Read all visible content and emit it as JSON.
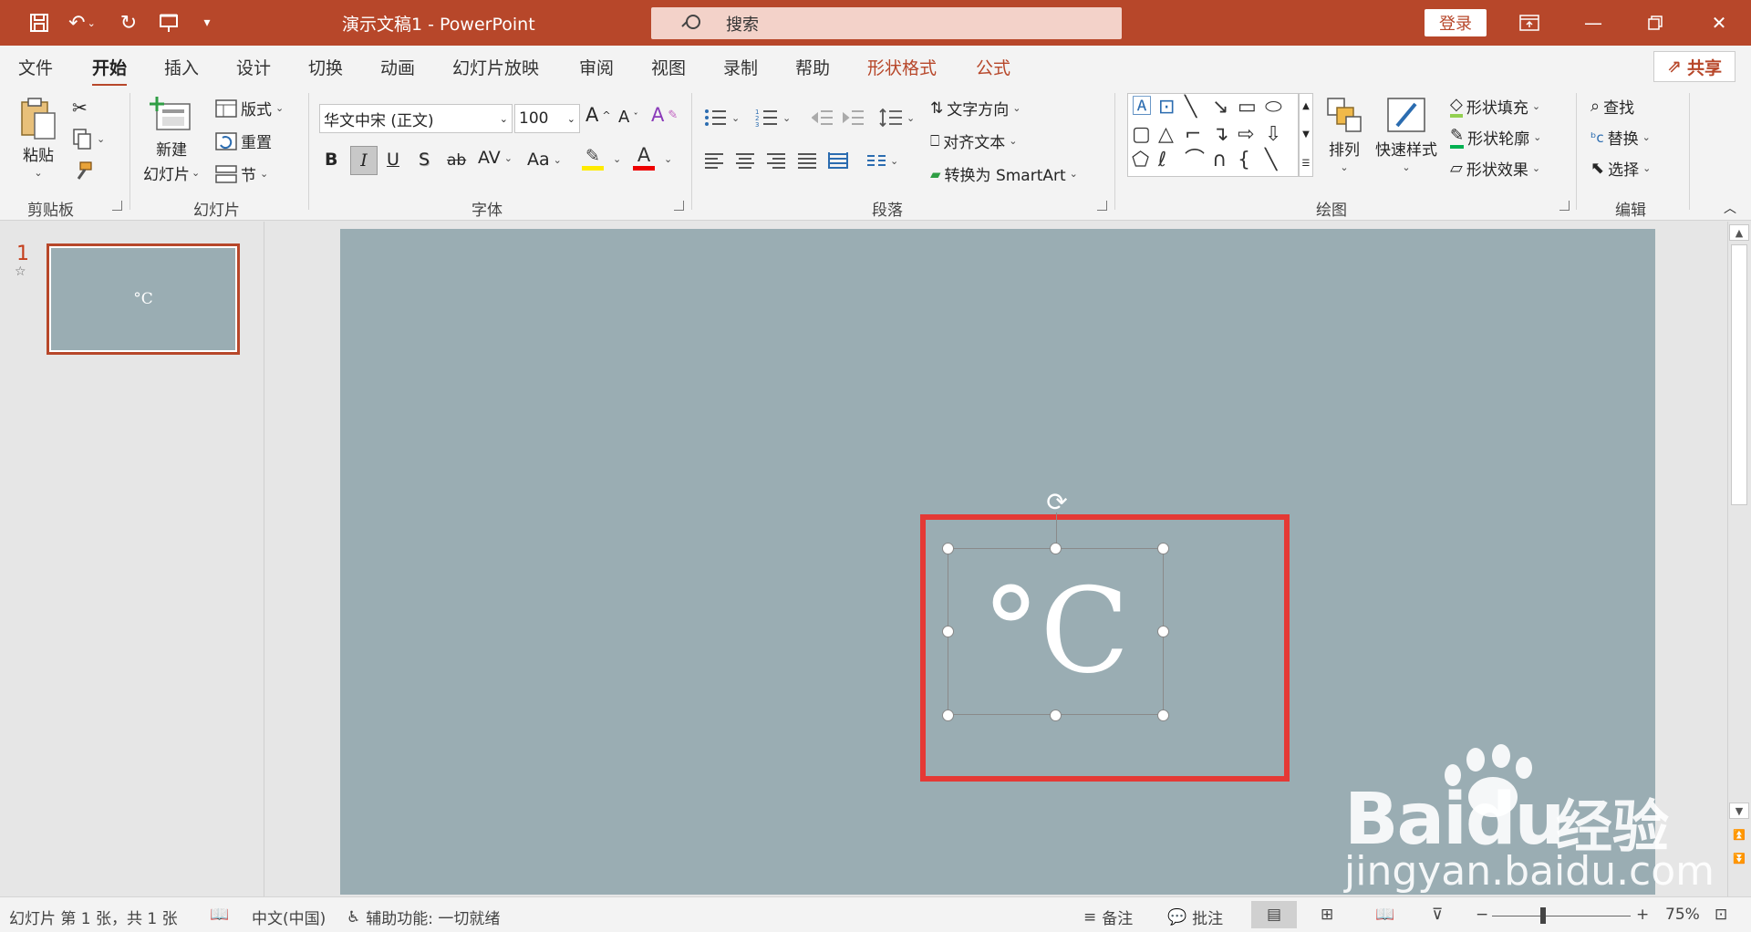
{
  "titlebar": {
    "doc_title": "演示文稿1  -  PowerPoint",
    "search_label": "搜索",
    "signin_label": "登录",
    "accent_color": "#b7472a"
  },
  "tabs": [
    "文件",
    "开始",
    "插入",
    "设计",
    "切换",
    "动画",
    "幻灯片放映",
    "审阅",
    "视图",
    "录制",
    "帮助",
    "形状格式",
    "公式"
  ],
  "active_tab": "开始",
  "share_label": "共享",
  "ribbon": {
    "clipboard": {
      "paste": "粘贴",
      "group": "剪贴板"
    },
    "slides": {
      "new_slide_1": "新建",
      "new_slide_2": "幻灯片",
      "layout": "版式",
      "reset": "重置",
      "section": "节",
      "group": "幻灯片"
    },
    "font": {
      "name": "华文中宋 (正文)",
      "size": "100",
      "bold": "B",
      "italic": "I",
      "underline": "U",
      "shadow": "S",
      "strike": "ab",
      "spacing": "AV",
      "case": "Aa",
      "group": "字体"
    },
    "paragraph": {
      "text_direction": "文字方向",
      "align_text": "对齐文本",
      "smartart": "转换为 SmartArt",
      "group": "段落"
    },
    "drawing": {
      "arrange": "排列",
      "quick_styles": "快速样式",
      "shape_fill": "形状填充",
      "shape_outline": "形状轮廓",
      "shape_effects": "形状效果",
      "group": "绘图"
    },
    "editing": {
      "find": "查找",
      "replace": "替换",
      "select": "选择",
      "group": "编辑"
    }
  },
  "thumbnail": {
    "number": "1",
    "text": "°C"
  },
  "slide": {
    "text": "°C",
    "background": "#9aadb3",
    "highlight_color": "#e53935"
  },
  "watermark": {
    "brand": "Bai",
    "brand2": "du",
    "cn": "经验",
    "url": "jingyan.baidu.com"
  },
  "statusbar": {
    "slide_info": "幻灯片 第 1 张，共 1 张",
    "language": "中文(中国)",
    "accessibility": "辅助功能: 一切就绪",
    "notes": "备注",
    "comments": "批注",
    "zoom": "75%"
  }
}
